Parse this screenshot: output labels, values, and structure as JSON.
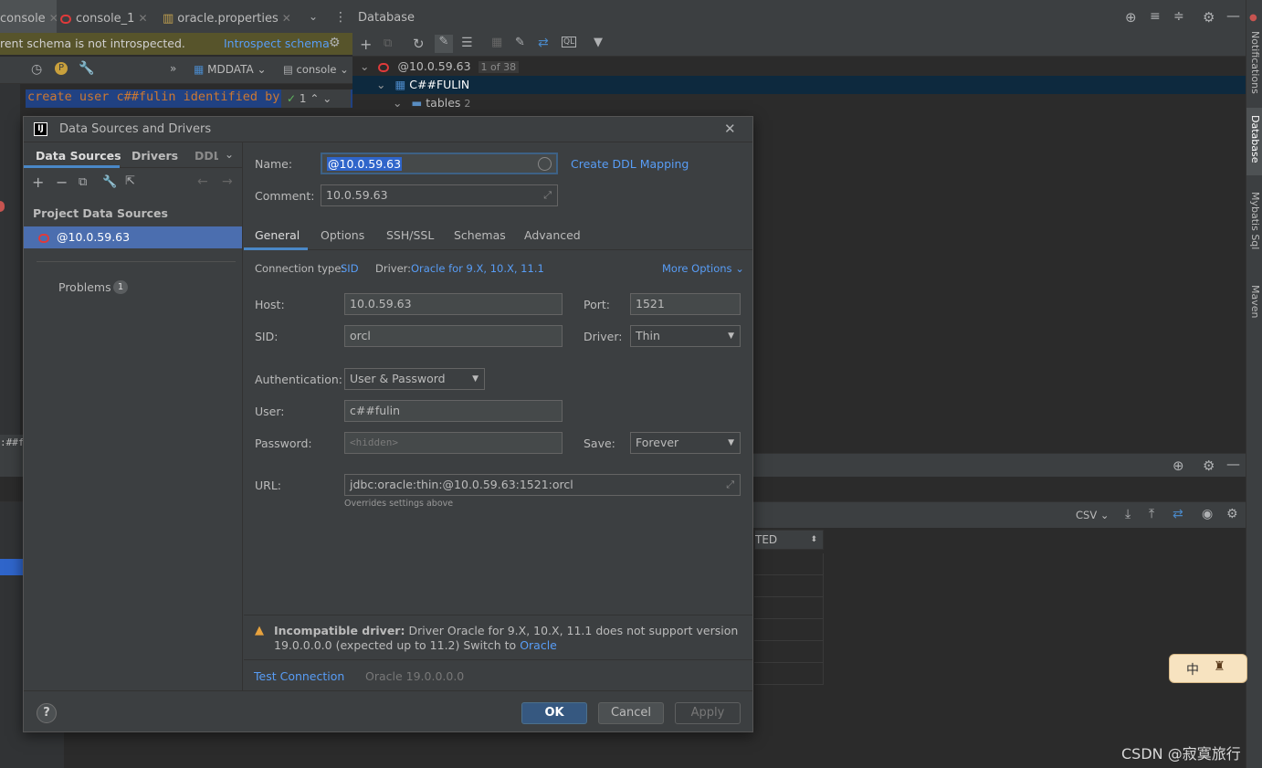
{
  "editor": {
    "tabs": [
      {
        "label": "console"
      },
      {
        "label": "console_1"
      },
      {
        "label": "oracle.properties"
      }
    ],
    "schema_warning": "rent schema is not introspected.",
    "introspect_link": "Introspect schema",
    "toolbar": {
      "datasource": "MDDATA",
      "session": "console"
    },
    "code": "create user c##fulin identified by",
    "run_count": "1",
    "bottom_fragment": ":##f"
  },
  "db_panel": {
    "title": "Database",
    "tree": [
      {
        "label": "@10.0.59.63",
        "badge": "1 of 38"
      },
      {
        "label": "C##FULIN"
      },
      {
        "label": "tables",
        "count": "2"
      }
    ]
  },
  "right_stripe": [
    "Notifications",
    "Database",
    "Mybatis Sql",
    "Maven"
  ],
  "services": {
    "export_format": "CSV",
    "column_header": "TED"
  },
  "dialog": {
    "title": "Data Sources and Drivers",
    "left_tabs": [
      "Data Sources",
      "Drivers",
      "DDL"
    ],
    "project_data_sources": "Project Data Sources",
    "selected_source": "@10.0.59.63",
    "problems_label": "Problems",
    "problems_count": "1",
    "name_label": "Name:",
    "name_value": "@10.0.59.63",
    "create_ddl_mapping": "Create DDL Mapping",
    "comment_label": "Comment:",
    "comment_value": "10.0.59.63",
    "tabs": [
      "General",
      "Options",
      "SSH/SSL",
      "Schemas",
      "Advanced"
    ],
    "connection_type_label": "Connection type:",
    "connection_type_value": "SID",
    "driver_label": "Driver:",
    "driver_value": "Oracle for 9.X, 10.X, 11.1",
    "more_options": "More Options",
    "host_label": "Host:",
    "host_value": "10.0.59.63",
    "port_label": "Port:",
    "port_value": "1521",
    "sid_label": "SID:",
    "sid_value": "orcl",
    "driver2_label": "Driver:",
    "driver2_value": "Thin",
    "auth_label": "Authentication:",
    "auth_value": "User & Password",
    "user_label": "User:",
    "user_value": "c##fulin",
    "password_label": "Password:",
    "password_placeholder": "<hidden>",
    "save_label": "Save:",
    "save_value": "Forever",
    "url_label": "URL:",
    "url_value": "jdbc:oracle:thin:@10.0.59.63:1521:orcl",
    "url_hint": "Overrides settings above",
    "warning_title": "Incompatible driver:",
    "warning_text_1": "Driver Oracle for 9.X, 10.X, 11.1 does not support version",
    "warning_text_2": "19.0.0.0.0 (expected up to 11.2) Switch to",
    "warning_link": "Oracle",
    "test_connection": "Test Connection",
    "server_version": "Oracle 19.0.0.0.0",
    "ok": "OK",
    "cancel": "Cancel",
    "apply": "Apply",
    "help": "?"
  },
  "ime": {
    "label": "中"
  },
  "watermark": "CSDN @寂寞旅行",
  "colors": {
    "accent": "#4a88c7",
    "link": "#589df6",
    "warning": "#e8a33e",
    "oracle_red": "#e03a3a"
  }
}
